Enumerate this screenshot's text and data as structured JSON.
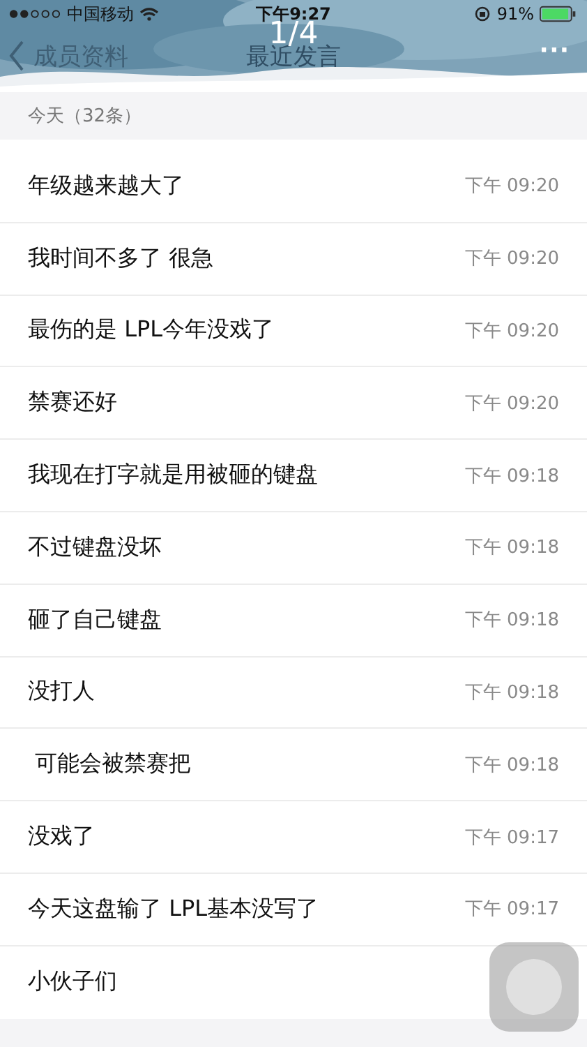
{
  "status_bar": {
    "carrier": "中国移动",
    "time": "下午9:27",
    "battery": "91%"
  },
  "nav": {
    "back": "成员资料",
    "title": "最近发言",
    "counter": "1/4",
    "more": "···"
  },
  "sections": [
    {
      "header": "今天（32条）",
      "messages": [
        {
          "text": "年级越来越大了",
          "time": "下午 09:20"
        },
        {
          "text": "我时间不多了 很急",
          "time": "下午 09:20"
        },
        {
          "text": "最伤的是 LPL今年没戏了",
          "time": "下午 09:20"
        },
        {
          "text": "禁赛还好",
          "time": "下午 09:20"
        },
        {
          "text": "我现在打字就是用被砸的键盘",
          "time": "下午 09:18"
        },
        {
          "text": "不过键盘没坏",
          "time": "下午 09:18"
        },
        {
          "text": "砸了自己键盘",
          "time": "下午 09:18"
        },
        {
          "text": "没打人",
          "time": "下午 09:18"
        },
        {
          "text": " 可能会被禁赛把",
          "time": "下午 09:18"
        },
        {
          "text": "没戏了",
          "time": "下午 09:17"
        },
        {
          "text": "今天这盘输了 LPL基本没写了",
          "time": "下午 09:17"
        },
        {
          "text": "小伙子们"
        }
      ]
    }
  ]
}
